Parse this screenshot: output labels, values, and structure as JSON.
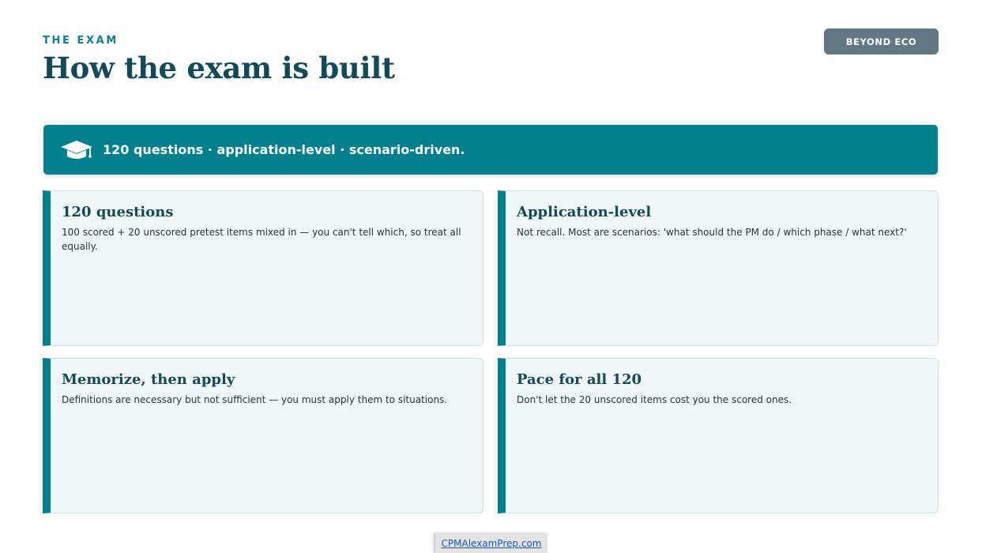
{
  "header": {
    "eyebrow": "THE EXAM",
    "title": "How the exam is built",
    "badge": "BEYOND ECO"
  },
  "banner": {
    "icon": "graduation-cap-icon",
    "text": "120 questions · application-level · scenario-driven."
  },
  "cards": [
    {
      "title": "120 questions",
      "text": "100 scored + 20 unscored pretest items mixed in — you can't tell which, so treat all equally."
    },
    {
      "title": "Application-level",
      "text": "Not recall. Most are scenarios: 'what should the PM do / which phase / what next?'"
    },
    {
      "title": "Memorize, then apply",
      "text": "Definitions are necessary but not sufficient — you must apply them to situations."
    },
    {
      "title": "Pace for all 120",
      "text": "Don't let the 20 unscored items cost you the scored ones."
    }
  ],
  "footer": {
    "link": "CPMAlexamPrep.com"
  },
  "colors": {
    "accent": "#00808c",
    "title": "#134a5a",
    "badge": "#627883",
    "card_bg": "#f1f6f7"
  }
}
